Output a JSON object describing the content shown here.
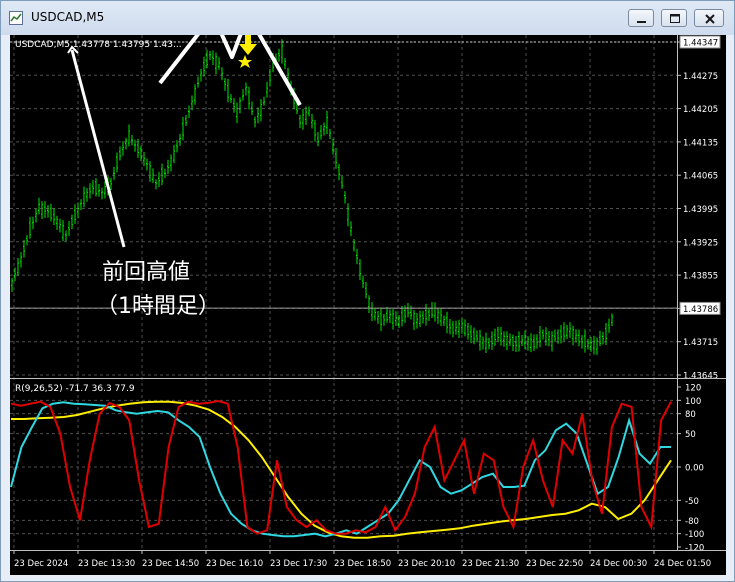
{
  "window": {
    "title": "USDCAD,M5",
    "buttons": {
      "minimize_icon": "minimize-icon",
      "maximize_icon": "maximize-icon",
      "close_icon": "close-icon"
    }
  },
  "colors": {
    "background": "#000000",
    "candles": "#00e600",
    "grid": "#4f4f4f",
    "axis_text": "#ffffff",
    "ind_red": "#e00000",
    "ind_cyan": "#2fd8e0",
    "ind_yellow": "#ffee00",
    "annotation": "#ffffff",
    "marker": "#ffee00"
  },
  "main_panel": {
    "info_label": "USDCAD,M5  1.43778 1.43795 1.43...",
    "price_ticks": [
      "1.44347",
      "1.44275",
      "1.44205",
      "1.44135",
      "1.44065",
      "1.43995",
      "1.43925",
      "1.43855",
      "1.43786",
      "1.43715",
      "1.43645"
    ],
    "annotation_line1": "前回高値",
    "annotation_line2": "（1時間足）"
  },
  "sub_panel": {
    "info_label": "R(9,26,52) -71.7 36.3 77.9",
    "level_ticks": [
      "120",
      "100",
      "80",
      "50",
      "0.00",
      "-50",
      "-80",
      "-100",
      "-120"
    ]
  },
  "time_axis": [
    "23 Dec 2024",
    "23 Dec 13:30",
    "23 Dec 14:50",
    "23 Dec 16:10",
    "23 Dec 17:30",
    "23 Dec 18:50",
    "23 Dec 20:10",
    "23 Dec 21:30",
    "23 Dec 22:50",
    "24 Dec 00:30",
    "24 Dec 01:50"
  ],
  "chart_data": {
    "type": "line",
    "symbol": "USDCAD",
    "timeframe": "M5",
    "price_ylim": [
      1.43645,
      1.44347
    ],
    "current_price": 1.43786,
    "price_series": [
      1.4384,
      1.4389,
      1.4395,
      1.44,
      1.4399,
      1.4397,
      1.4394,
      1.4398,
      1.4402,
      1.4404,
      1.4403,
      1.4405,
      1.4411,
      1.4415,
      1.4412,
      1.4409,
      1.4405,
      1.4407,
      1.4411,
      1.4416,
      1.4422,
      1.4428,
      1.4432,
      1.443,
      1.4424,
      1.442,
      1.4425,
      1.4418,
      1.4422,
      1.443,
      1.4433,
      1.4425,
      1.4418,
      1.442,
      1.4414,
      1.4418,
      1.441,
      1.4402,
      1.4392,
      1.4384,
      1.4378,
      1.4376,
      1.4377,
      1.4376,
      1.4378,
      1.4376,
      1.4377,
      1.4378,
      1.4376,
      1.4374,
      1.4375,
      1.4373,
      1.4372,
      1.4371,
      1.4373,
      1.4372,
      1.4371,
      1.4372,
      1.4371,
      1.4373,
      1.4372,
      1.4373,
      1.4374,
      1.4372,
      1.4371,
      1.4371,
      1.4373,
      1.4378
    ],
    "indicator": {
      "name": "R(9,26,52)",
      "values": [
        -71.7,
        36.3,
        77.9
      ],
      "ylim": [
        -120,
        120
      ],
      "levels": [
        100,
        80,
        50,
        0,
        -50,
        -80,
        -100
      ],
      "series": [
        {
          "color": "#e00000",
          "values": [
            95,
            92,
            95,
            98,
            90,
            50,
            -30,
            -80,
            10,
            80,
            96,
            90,
            70,
            -20,
            -90,
            -85,
            30,
            90,
            98,
            95,
            96,
            99,
            95,
            30,
            -90,
            -100,
            -95,
            10,
            -60,
            -80,
            -90,
            -80,
            -95,
            -100,
            -100,
            -95,
            -98,
            -90,
            -60,
            -95,
            -75,
            -40,
            30,
            60,
            -20,
            10,
            40,
            -40,
            20,
            10,
            -60,
            -90,
            0,
            40,
            -20,
            -60,
            40,
            20,
            80,
            -20,
            -70,
            60,
            95,
            90,
            -60,
            -90,
            70,
            98
          ]
        },
        {
          "color": "#2fd8e0",
          "values": [
            -30,
            30,
            60,
            88,
            95,
            97,
            95,
            94,
            93,
            92,
            85,
            82,
            80,
            82,
            84,
            82,
            70,
            60,
            45,
            0,
            -40,
            -70,
            -85,
            -95,
            -100,
            -102,
            -104,
            -104,
            -102,
            -100,
            -104,
            -100,
            -95,
            -100,
            -90,
            -80,
            -70,
            -50,
            -20,
            10,
            0,
            -30,
            -40,
            -35,
            -25,
            -15,
            -10,
            -30,
            -30,
            -28,
            10,
            25,
            55,
            65,
            50,
            5,
            -40,
            -30,
            15,
            70,
            20,
            5,
            30,
            30
          ]
        },
        {
          "color": "#ffee00",
          "values": [
            72,
            72,
            73,
            74,
            75,
            78,
            83,
            88,
            92,
            95,
            97,
            98,
            98,
            96,
            92,
            86,
            75,
            60,
            40,
            15,
            -15,
            -45,
            -70,
            -88,
            -98,
            -104,
            -106,
            -106,
            -104,
            -103,
            -100,
            -98,
            -96,
            -94,
            -92,
            -88,
            -85,
            -82,
            -80,
            -78,
            -75,
            -72,
            -70,
            -65,
            -55,
            -60,
            -78,
            -70,
            -50,
            -20,
            10
          ]
        }
      ]
    },
    "annotation": "前回高値（1時間足）"
  }
}
